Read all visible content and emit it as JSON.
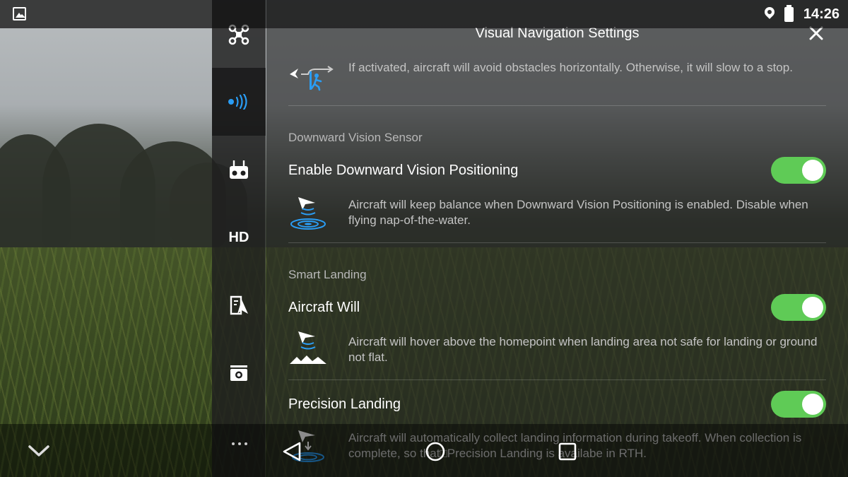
{
  "status_bar": {
    "time": "14:26"
  },
  "side_rail": {
    "items": [
      {
        "icon": "aircraft-icon",
        "active": false
      },
      {
        "icon": "visual-navigation-icon",
        "active": true
      },
      {
        "icon": "remote-controller-icon",
        "active": false
      },
      {
        "icon": "hd-label",
        "label": "HD",
        "active": false
      },
      {
        "icon": "flight-map-icon",
        "active": false
      },
      {
        "icon": "camera-icon",
        "active": false
      }
    ],
    "accent_color": "#2a9df4"
  },
  "panel": {
    "title": "Visual Navigation Settings",
    "top_item": {
      "description": "If activated, aircraft will avoid obstacles horizontally. Otherwise, it will slow to a stop."
    },
    "sections": [
      {
        "header": "Downward Vision Sensor",
        "items": [
          {
            "title": "Enable Downward Vision Positioning",
            "enabled": true,
            "description": "Aircraft will keep balance when Downward Vision Positioning is enabled. Disable when flying nap-of-the-water."
          }
        ]
      },
      {
        "header": "Smart Landing",
        "items": [
          {
            "title": "Aircraft Will",
            "enabled": true,
            "description": "Aircraft will hover above the homepoint when landing area not safe for landing or ground not flat."
          },
          {
            "title": "Precision Landing",
            "enabled": true,
            "description": "Aircraft will automatically collect landing information during takeoff. When collection is complete, so that□Precision Landing is availabe in RTH."
          }
        ]
      }
    ]
  },
  "colors": {
    "toggle_on": "#5fcb56"
  }
}
